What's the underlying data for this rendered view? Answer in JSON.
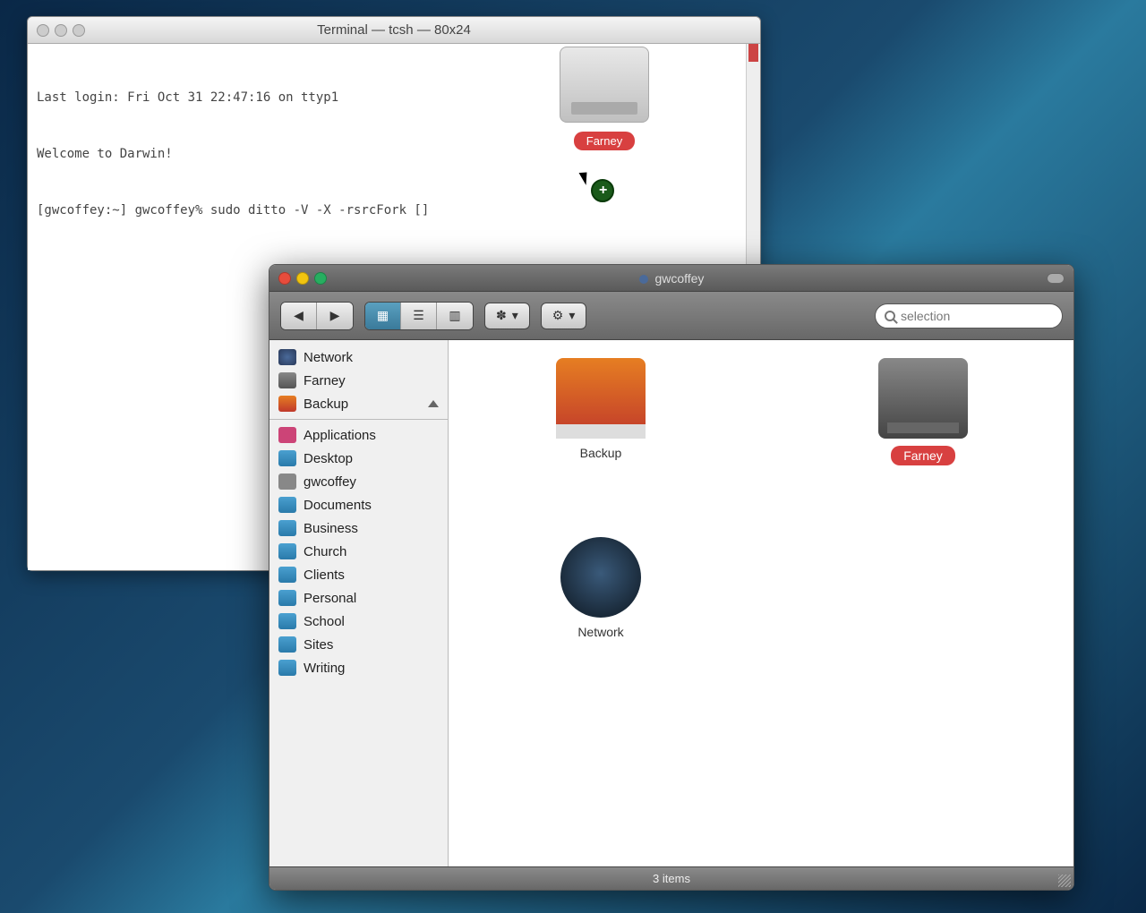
{
  "terminal": {
    "title": "Terminal — tcsh — 80x24",
    "line1": "Last login: Fri Oct 31 22:47:16 on ttyp1",
    "line2": "Welcome to Darwin!",
    "line3": "[gwcoffey:~] gwcoffey% sudo ditto -V -X -rsrcFork []"
  },
  "drag_disk": {
    "label": "Farney"
  },
  "finder": {
    "title": "gwcoffey",
    "search_placeholder": "selection",
    "status": "3 items",
    "toolbar": {
      "action_label": "",
      "gear_label": ""
    },
    "sidebar": {
      "items": [
        {
          "label": "Network",
          "icon": "network"
        },
        {
          "label": "Farney",
          "icon": "disk"
        },
        {
          "label": "Backup",
          "icon": "fire",
          "eject": true
        }
      ],
      "places": [
        {
          "label": "Applications",
          "icon": "app"
        },
        {
          "label": "Desktop",
          "icon": "folder"
        },
        {
          "label": "gwcoffey",
          "icon": "home"
        },
        {
          "label": "Documents",
          "icon": "folder"
        },
        {
          "label": "Business",
          "icon": "folder"
        },
        {
          "label": "Church",
          "icon": "folder"
        },
        {
          "label": "Clients",
          "icon": "folder"
        },
        {
          "label": "Personal",
          "icon": "folder"
        },
        {
          "label": "School",
          "icon": "folder"
        },
        {
          "label": "Sites",
          "icon": "folder"
        },
        {
          "label": "Writing",
          "icon": "folder"
        }
      ]
    },
    "content": {
      "backup_label": "Backup",
      "farney_label": "Farney",
      "network_label": "Network"
    }
  }
}
